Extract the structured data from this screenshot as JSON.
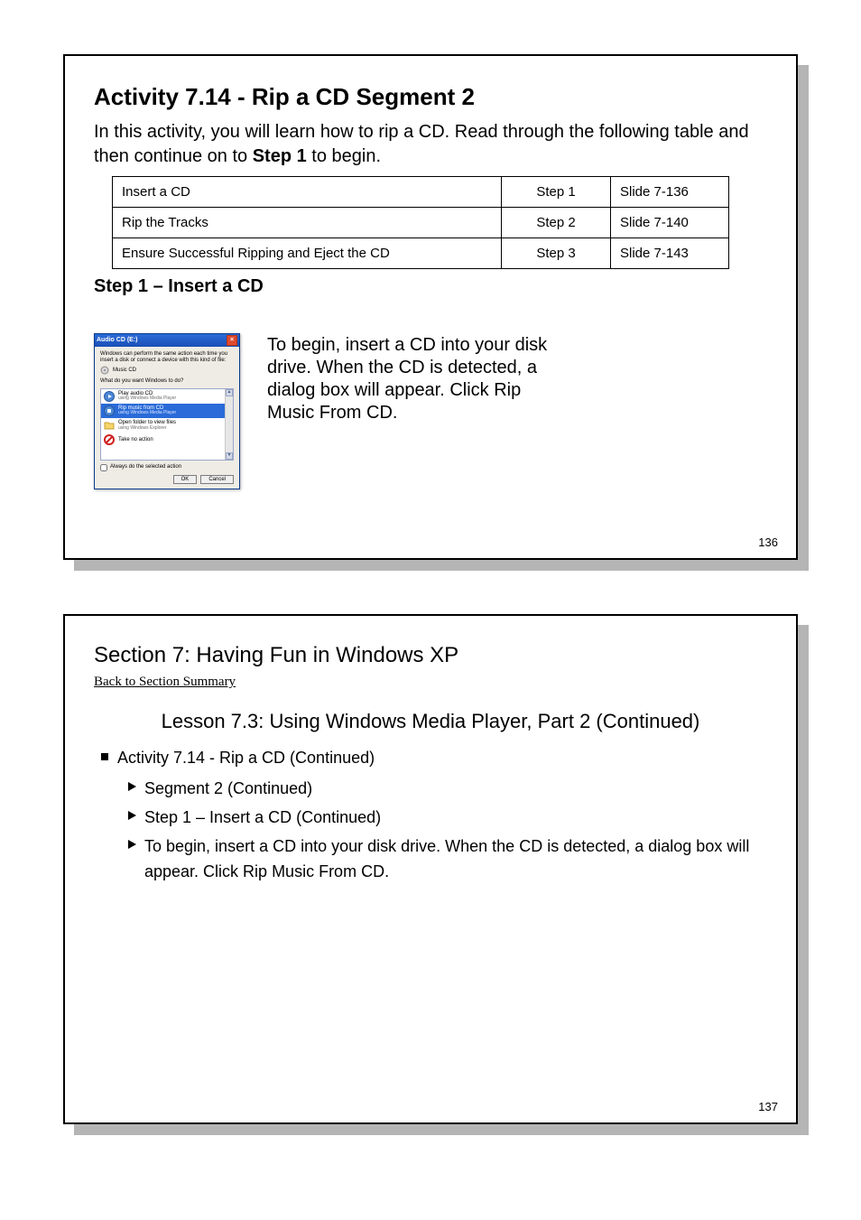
{
  "slide1": {
    "heading": "Activity 7.14 - Rip a CD",
    "segment": "Segment 2",
    "bodyPrefix": "In this activity, you will learn how to rip a CD. Read through the following table and then continue on to ",
    "step1": "Step 1",
    "bodySuffix": " to begin.",
    "table": [
      {
        "text": "Insert a CD",
        "step": "Step 1",
        "slide": "Slide 7-136"
      },
      {
        "text": "Rip the Tracks",
        "step": "Step 2",
        "slide": "Slide 7-140"
      },
      {
        "text": "Ensure Successful Ripping and Eject the CD",
        "step": "Step 3",
        "slide": "Slide 7-143"
      }
    ],
    "stepLabel": "Step 1 – Insert a CD",
    "dialog": {
      "title": "Audio CD (E:)",
      "introText": "Windows can perform the same action each time you insert a disk or connect a device with this kind of file:",
      "cdLabel": "Music CD",
      "question": "What do you want Windows to do?",
      "options": [
        {
          "label": "Play audio CD",
          "sub": "using Windows Media Player",
          "selected": false,
          "icon": "play"
        },
        {
          "label": "Rip music from CD",
          "sub": "using Windows Media Player",
          "selected": true,
          "icon": "rip"
        },
        {
          "label": "Open folder to view files",
          "sub": "using Windows Explorer",
          "selected": false,
          "icon": "folder"
        },
        {
          "label": "Take no action",
          "sub": "",
          "selected": false,
          "icon": "no"
        }
      ],
      "always": "Always do the selected action",
      "ok": "OK",
      "cancel": "Cancel"
    },
    "caption": [
      "To begin, insert a CD into your disk",
      "drive. When the CD is detected, a",
      "dialog box will appear. Click Rip",
      "Music From CD."
    ],
    "pageNum": "136"
  },
  "slide2": {
    "heading": "Section 7: Having Fun in Windows XP",
    "back": "Back to Section Summary",
    "subtitle": "Lesson 7.3: Using Windows Media Player, Part 2 (Continued)",
    "bullets": [
      {
        "level": 1,
        "text": "Activity 7.14 - Rip a CD (Continued)"
      },
      {
        "level": 2,
        "text": "Segment 2 (Continued)"
      },
      {
        "level": 2,
        "text": "Step 1 – Insert a CD (Continued)"
      },
      {
        "level": 2,
        "text": "To begin, insert a CD into your disk drive. When the CD is detected, a dialog box will appear. Click Rip Music From CD."
      }
    ],
    "pageNum": "137"
  }
}
